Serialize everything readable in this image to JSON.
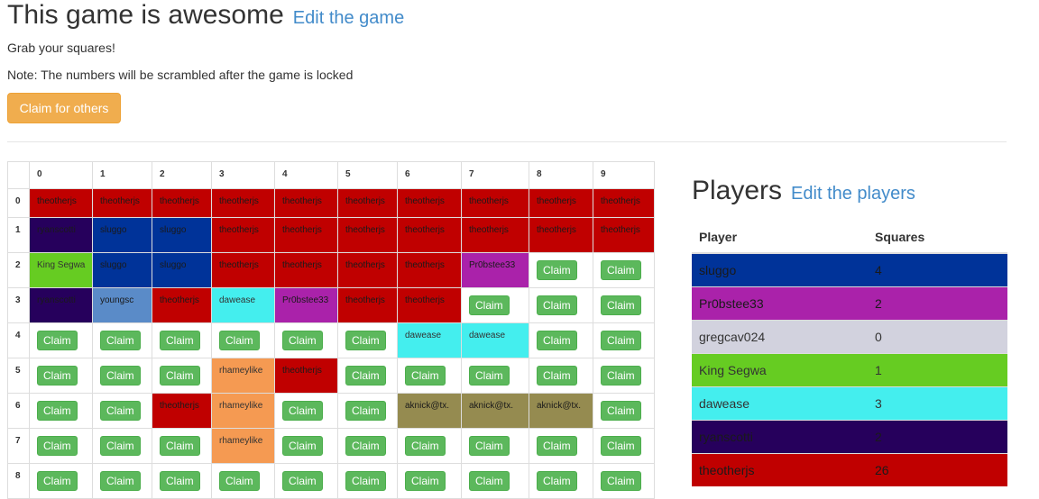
{
  "header": {
    "title": "This game is awesome",
    "edit_link": "Edit the game",
    "subtitle": "Grab your squares!",
    "note": "Note: The numbers will be scrambled after the game is locked",
    "claim_others_label": "Claim for others"
  },
  "colors": {
    "theotherjs": "#c00000",
    "ryanscotti": "#26005c",
    "sluggo": "#003399",
    "King Segwa": "#66cc22",
    "youngsc": "#5a8bc8",
    "dawease": "#44eeee",
    "Pr0bstee33": "#aa22aa",
    "rhameylike": "#f59a52",
    "aknick@tx.": "#958b50",
    "gregcav024": "#d2d2de"
  },
  "grid": {
    "columns": [
      "0",
      "1",
      "2",
      "3",
      "4",
      "5",
      "6",
      "7",
      "8",
      "9"
    ],
    "rows": [
      {
        "label": "0",
        "cells": [
          "theotherjs",
          "theotherjs",
          "theotherjs",
          "theotherjs",
          "theotherjs",
          "theotherjs",
          "theotherjs",
          "theotherjs",
          "theotherjs",
          "theotherjs"
        ]
      },
      {
        "label": "1",
        "cells": [
          "ryanscotti",
          "sluggo",
          "sluggo",
          "theotherjs",
          "theotherjs",
          "theotherjs",
          "theotherjs",
          "theotherjs",
          "theotherjs",
          "theotherjs"
        ]
      },
      {
        "label": "2",
        "cells": [
          "King Segwa",
          "sluggo",
          "sluggo",
          "theotherjs",
          "theotherjs",
          "theotherjs",
          "theotherjs",
          "Pr0bstee33",
          null,
          null
        ]
      },
      {
        "label": "3",
        "cells": [
          "ryanscotti",
          "youngsc",
          "theotherjs",
          "dawease",
          "Pr0bstee33",
          "theotherjs",
          "theotherjs",
          null,
          null,
          null
        ]
      },
      {
        "label": "4",
        "cells": [
          null,
          null,
          null,
          null,
          null,
          null,
          "dawease",
          "dawease",
          null,
          null
        ]
      },
      {
        "label": "5",
        "cells": [
          null,
          null,
          null,
          "rhameylike",
          "theotherjs",
          null,
          null,
          null,
          null,
          null
        ]
      },
      {
        "label": "6",
        "cells": [
          null,
          null,
          "theotherjs",
          "rhameylike",
          null,
          null,
          "aknick@tx.",
          "aknick@tx.",
          "aknick@tx.",
          null
        ]
      },
      {
        "label": "7",
        "cells": [
          null,
          null,
          null,
          "rhameylike",
          null,
          null,
          null,
          null,
          null,
          null
        ]
      },
      {
        "label": "8",
        "cells": [
          null,
          null,
          null,
          null,
          null,
          null,
          null,
          null,
          null,
          null
        ]
      }
    ],
    "claim_label": "Claim"
  },
  "players": {
    "title": "Players",
    "edit_link": "Edit the players",
    "col_player": "Player",
    "col_squares": "Squares",
    "rows": [
      {
        "name": "sluggo",
        "squares": "4",
        "color": "#003399"
      },
      {
        "name": "Pr0bstee33",
        "squares": "2",
        "color": "#aa22aa"
      },
      {
        "name": "gregcav024",
        "squares": "0",
        "color": "#d2d2de"
      },
      {
        "name": "King Segwa",
        "squares": "1",
        "color": "#66cc22"
      },
      {
        "name": "dawease",
        "squares": "3",
        "color": "#44eeee"
      },
      {
        "name": "ryanscotti",
        "squares": "2",
        "color": "#26005c"
      },
      {
        "name": "theotherjs",
        "squares": "26",
        "color": "#c00000"
      }
    ]
  }
}
